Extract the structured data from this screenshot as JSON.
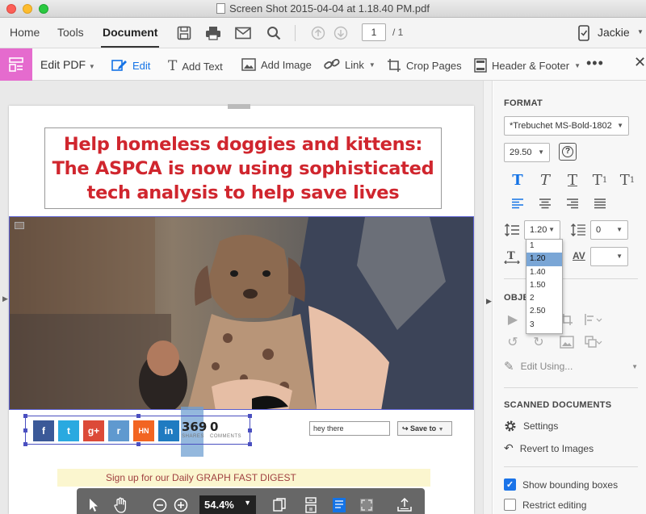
{
  "window": {
    "title": "Screen Shot 2015-04-04 at 1.18.40 PM.pdf"
  },
  "nav": {
    "tabs": [
      "Home",
      "Tools",
      "Document"
    ],
    "active_tab": "Document",
    "page_current": "1",
    "page_total": "/ 1",
    "user": "Jackie"
  },
  "toolbar": {
    "title": "Edit PDF",
    "tools": {
      "edit": "Edit",
      "add_text": "Add Text",
      "add_image": "Add Image",
      "link": "Link",
      "crop": "Crop Pages",
      "header_footer": "Header & Footer"
    },
    "more": "•••",
    "close": "✕"
  },
  "document": {
    "headline": "Help homeless doggies and kittens: The ASPCA is now using sophisticated tech analysis to help save lives",
    "social": {
      "buttons": [
        "f",
        "t",
        "g+",
        "r",
        "HN",
        "in"
      ],
      "shares_count": "369",
      "shares_label": "SHARES",
      "comments_count": "0",
      "comments_label": "COMMENTS"
    },
    "comment_input": "hey there",
    "save_to": "Save to",
    "sign_bar_text": "Sign up for our Daily GRAPH FAST DIGEST",
    "zoom": "54.4%"
  },
  "panel": {
    "format_title": "FORMAT",
    "font_family": "*Trebuchet MS-Bold-1802",
    "font_size": "29.50",
    "line_spacing": "1.20",
    "para_spacing": "0",
    "line_spacing_options": [
      "1",
      "1.20",
      "1.40",
      "1.50",
      "2",
      "2.50",
      "3"
    ],
    "line_spacing_selected": "1.20",
    "objects_title": "OBJECTS",
    "edit_using": "Edit Using...",
    "scanned_title": "SCANNED DOCUMENTS",
    "settings": "Settings",
    "revert": "Revert to Images",
    "show_bounding": "Show bounding boxes",
    "show_bounding_checked": true,
    "restrict_editing": "Restrict editing",
    "restrict_editing_checked": false
  },
  "colors": {
    "accent": "#1473e6",
    "headline": "#d0262e",
    "edit_pdf_icon_bg": "#e56bce",
    "facebook": "#3b5998",
    "twitter": "#2aa9e0",
    "google": "#dc4a38",
    "reddit": "#5f99cf",
    "hn": "#f26522",
    "linkedin": "#1f7bc1"
  }
}
